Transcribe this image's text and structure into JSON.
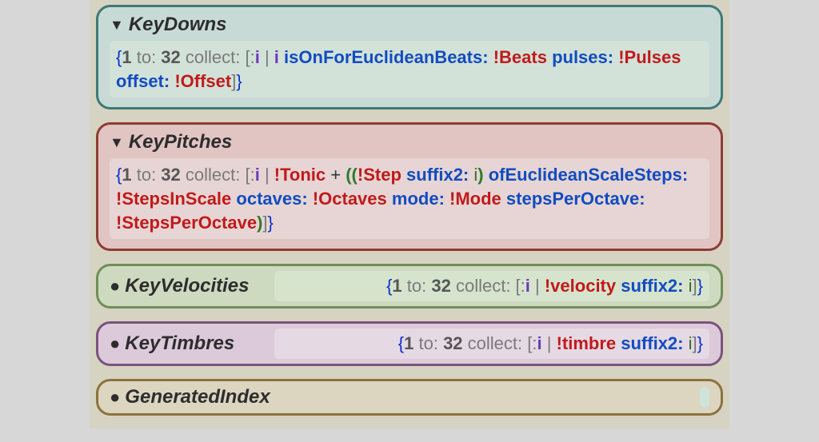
{
  "cards": {
    "keyDowns": {
      "title": "KeyDowns",
      "tokens": [
        {
          "cls": "t-brace",
          "t": "{"
        },
        {
          "cls": "t-num",
          "t": "1"
        },
        {
          "cls": "t-kw",
          "t": " to: "
        },
        {
          "cls": "t-num",
          "t": "32"
        },
        {
          "cls": "t-kw",
          "t": " collect: "
        },
        {
          "cls": "t-kw",
          "t": "[:"
        },
        {
          "cls": "t-var",
          "t": "i"
        },
        {
          "cls": "t-kw",
          "t": " | "
        },
        {
          "cls": "t-var",
          "t": "i"
        },
        {
          "cls": "",
          "t": " "
        },
        {
          "cls": "t-msg",
          "t": "isOnForEuclideanBeats:"
        },
        {
          "cls": "",
          "t": " "
        },
        {
          "cls": "t-bang",
          "t": "!Beats"
        },
        {
          "cls": "",
          "t": " "
        },
        {
          "cls": "t-msg",
          "t": "pulses:"
        },
        {
          "cls": "",
          "t": " "
        },
        {
          "cls": "t-bang",
          "t": "!Pulses"
        },
        {
          "cls": "",
          "t": " "
        },
        {
          "cls": "t-msg",
          "t": "offset:"
        },
        {
          "cls": "",
          "t": " "
        },
        {
          "cls": "t-bang",
          "t": "!Offset"
        },
        {
          "cls": "t-kw",
          "t": "]"
        },
        {
          "cls": "t-brace",
          "t": "}"
        }
      ]
    },
    "keyPitches": {
      "title": "KeyPitches",
      "tokens": [
        {
          "cls": "t-brace",
          "t": "{"
        },
        {
          "cls": "t-num",
          "t": "1"
        },
        {
          "cls": "t-kw",
          "t": " to: "
        },
        {
          "cls": "t-num",
          "t": "32"
        },
        {
          "cls": "t-kw",
          "t": " collect: "
        },
        {
          "cls": "t-kw",
          "t": "[:"
        },
        {
          "cls": "t-var",
          "t": "i"
        },
        {
          "cls": "t-kw",
          "t": " | "
        },
        {
          "cls": "t-bang",
          "t": "!Tonic"
        },
        {
          "cls": "",
          "t": " + "
        },
        {
          "cls": "t-par",
          "t": "(("
        },
        {
          "cls": "t-bang",
          "t": "!Step"
        },
        {
          "cls": "",
          "t": " "
        },
        {
          "cls": "t-msg",
          "t": "suffix2:"
        },
        {
          "cls": "",
          "t": " "
        },
        {
          "cls": "t-i",
          "t": "i"
        },
        {
          "cls": "t-par",
          "t": ")"
        },
        {
          "cls": "",
          "t": " "
        },
        {
          "cls": "t-msg",
          "t": "ofEuclideanScaleSteps:"
        },
        {
          "cls": "",
          "t": " "
        },
        {
          "cls": "t-bang",
          "t": "!StepsInScale"
        },
        {
          "cls": "",
          "t": " "
        },
        {
          "cls": "t-msg",
          "t": "octaves:"
        },
        {
          "cls": "",
          "t": " "
        },
        {
          "cls": "t-bang",
          "t": "!Octaves"
        },
        {
          "cls": "",
          "t": " "
        },
        {
          "cls": "t-msg",
          "t": "mode:"
        },
        {
          "cls": "",
          "t": " "
        },
        {
          "cls": "t-bang",
          "t": "!Mode"
        },
        {
          "cls": "",
          "t": " "
        },
        {
          "cls": "t-msg",
          "t": "stepsPerOctave:"
        },
        {
          "cls": "",
          "t": " "
        },
        {
          "cls": "t-bang",
          "t": "!StepsPerOctave"
        },
        {
          "cls": "t-par",
          "t": ")"
        },
        {
          "cls": "t-kw",
          "t": "]"
        },
        {
          "cls": "t-brace",
          "t": "}"
        }
      ]
    },
    "keyVelocities": {
      "title": "KeyVelocities",
      "tokens": [
        {
          "cls": "t-brace",
          "t": "{"
        },
        {
          "cls": "t-num",
          "t": "1"
        },
        {
          "cls": "t-kw",
          "t": " to: "
        },
        {
          "cls": "t-num",
          "t": "32"
        },
        {
          "cls": "t-kw",
          "t": " collect: "
        },
        {
          "cls": "t-kw",
          "t": "[:"
        },
        {
          "cls": "t-var",
          "t": "i"
        },
        {
          "cls": "t-kw",
          "t": " | "
        },
        {
          "cls": "t-bang",
          "t": "!velocity"
        },
        {
          "cls": "",
          "t": " "
        },
        {
          "cls": "t-msg",
          "t": "suffix2:"
        },
        {
          "cls": "",
          "t": " "
        },
        {
          "cls": "t-i",
          "t": "i"
        },
        {
          "cls": "t-kw",
          "t": "]"
        },
        {
          "cls": "t-brace",
          "t": "}"
        }
      ]
    },
    "keyTimbres": {
      "title": "KeyTimbres",
      "tokens": [
        {
          "cls": "t-brace",
          "t": "{"
        },
        {
          "cls": "t-num",
          "t": "1"
        },
        {
          "cls": "t-kw",
          "t": " to: "
        },
        {
          "cls": "t-num",
          "t": "32"
        },
        {
          "cls": "t-kw",
          "t": " collect: "
        },
        {
          "cls": "t-kw",
          "t": "[:"
        },
        {
          "cls": "t-var",
          "t": "i"
        },
        {
          "cls": "t-kw",
          "t": " | "
        },
        {
          "cls": "t-bang",
          "t": "!timbre"
        },
        {
          "cls": "",
          "t": " "
        },
        {
          "cls": "t-msg",
          "t": "suffix2:"
        },
        {
          "cls": "",
          "t": " "
        },
        {
          "cls": "t-i",
          "t": "i"
        },
        {
          "cls": "t-kw",
          "t": "]"
        },
        {
          "cls": "t-brace",
          "t": "}"
        }
      ]
    },
    "generatedIndex": {
      "title": "GeneratedIndex"
    }
  }
}
